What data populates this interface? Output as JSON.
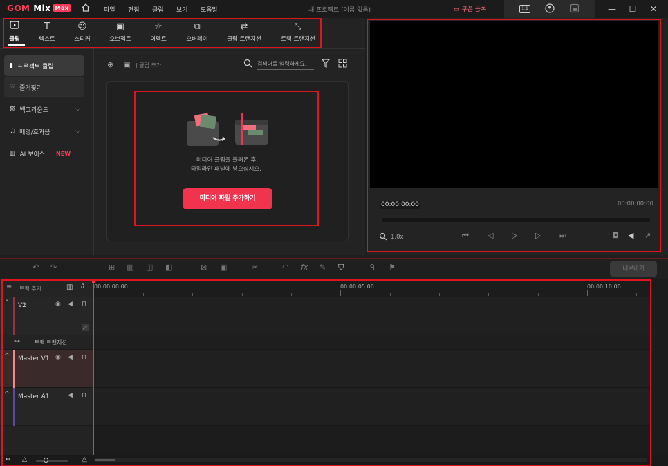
{
  "app": {
    "logo_main": "GOM",
    "logo_mix": "Mix",
    "logo_badge": "Max",
    "menu": [
      "파일",
      "편집",
      "클립",
      "보기",
      "도움말"
    ],
    "document_title": "새 프로젝트 (이름 없음)",
    "coupon_label": "쿠폰 등록",
    "ratio_label": "1:1"
  },
  "tools": [
    {
      "label": "클립",
      "icon": "clip-icon"
    },
    {
      "label": "텍스트",
      "icon": "text-icon"
    },
    {
      "label": "스티커",
      "icon": "sticker-icon"
    },
    {
      "label": "오브젝트",
      "icon": "object-icon"
    },
    {
      "label": "이펙트",
      "icon": "effect-icon"
    },
    {
      "label": "오버레이",
      "icon": "overlay-icon"
    },
    {
      "label": "클립 트랜지션",
      "icon": "clip-transition-icon"
    },
    {
      "label": "트랙 트랜지션",
      "icon": "track-transition-icon"
    }
  ],
  "sidebar": {
    "items": [
      {
        "label": "프로젝트 클립"
      },
      {
        "label": "즐겨찾기"
      },
      {
        "label": "백그라운드"
      },
      {
        "label": "배경/효과음"
      },
      {
        "label": "AI 보이스",
        "badge": "NEW"
      }
    ]
  },
  "media": {
    "clip_add_label": "| 클립 추가",
    "search_placeholder": "검색어를 입력하세요.",
    "drop_line1": "미디어 클립을 불러온 후",
    "drop_line2": "타임라인 패널에 넣으십시오.",
    "add_button": "미디어 파일 추가하기"
  },
  "preview": {
    "current_time": "00:00:00:00",
    "total_time": "00:00:00:00",
    "speed": "1.0x"
  },
  "toolbar": {
    "export_label": "내보내기"
  },
  "timeline": {
    "add_track_label": "트랙 추가",
    "ruler": [
      "00:00:00:00",
      "00:00:05:00",
      "00:00:10:00"
    ],
    "tracks": [
      {
        "name": "V2"
      },
      {
        "name": "트랙 트랜지션"
      },
      {
        "name": "Master V1"
      },
      {
        "name": "Master A1"
      }
    ]
  },
  "colors": {
    "accent": "#f0344e",
    "highlight_box": "#e0141e"
  }
}
